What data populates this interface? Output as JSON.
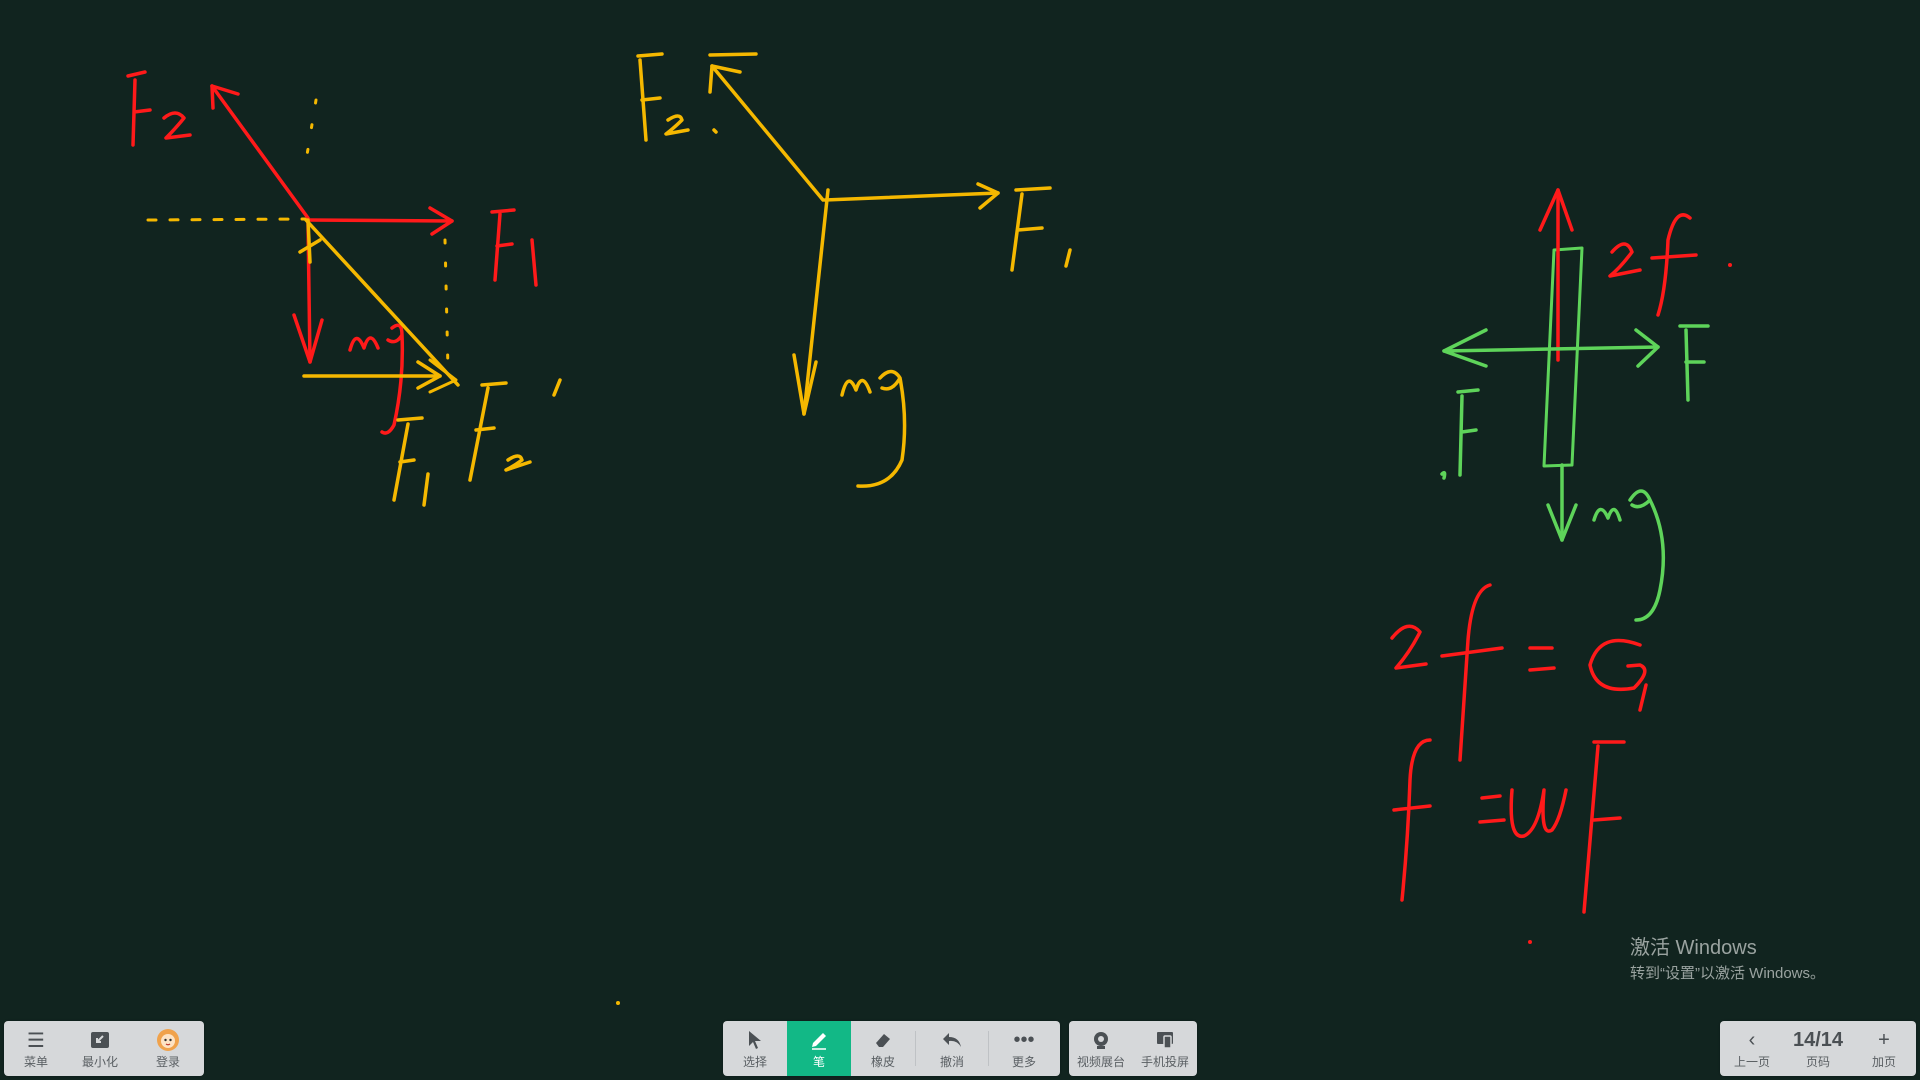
{
  "canvas": {
    "ink_colors": {
      "red": "#ff1a1a",
      "yellow": "#f5b800",
      "green": "#5ed45a"
    }
  },
  "watermark": {
    "title": "激活 Windows",
    "subtitle": "转到“设置”以激活 Windows。"
  },
  "left_toolbar": {
    "items": [
      {
        "label": "菜单",
        "icon": "menu-icon"
      },
      {
        "label": "最小化",
        "icon": "minimize-icon"
      },
      {
        "label": "登录",
        "icon": "avatar-icon"
      }
    ]
  },
  "center_toolbar": {
    "items": [
      {
        "label": "选择",
        "icon": "cursor-icon"
      },
      {
        "label": "笔",
        "icon": "pen-icon",
        "active": true
      },
      {
        "label": "橡皮",
        "icon": "eraser-icon"
      },
      {
        "label": "撤消",
        "icon": "undo-icon"
      },
      {
        "label": "更多",
        "icon": "more-icon"
      }
    ]
  },
  "media_toolbar": {
    "items": [
      {
        "label": "视频展台",
        "icon": "camera-icon"
      },
      {
        "label": "手机投屏",
        "icon": "phone-cast-icon"
      }
    ]
  },
  "right_toolbar": {
    "prev_label": "上一页",
    "page_indicator": "14/14",
    "page_label": "页码",
    "add_label": "加页"
  }
}
